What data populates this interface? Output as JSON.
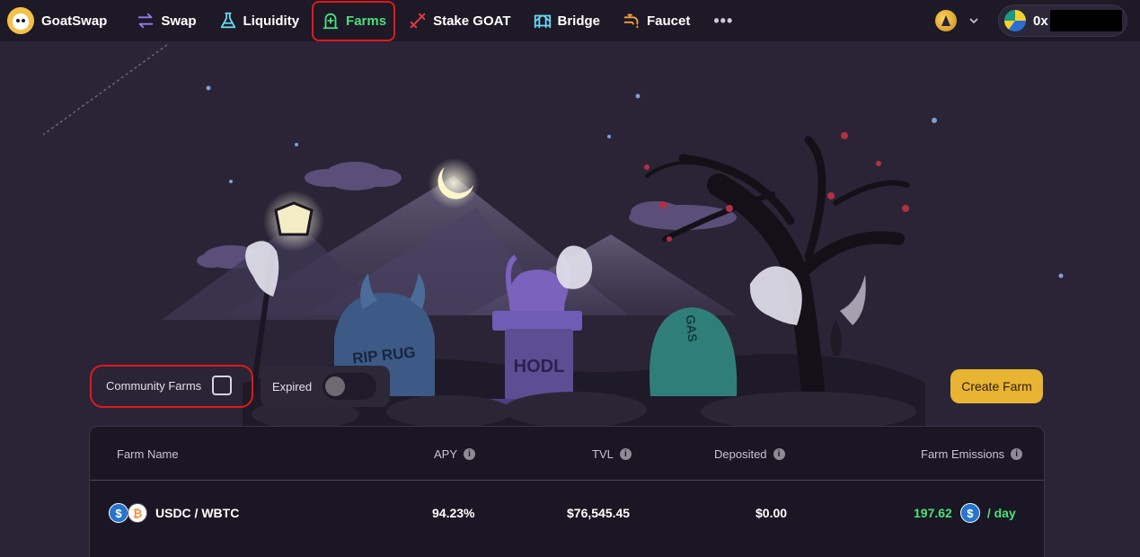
{
  "brand": {
    "name": "GoatSwap"
  },
  "nav": {
    "items": [
      {
        "label": "Swap",
        "icon": "swap-arrows-icon",
        "active": false
      },
      {
        "label": "Liquidity",
        "icon": "flask-icon",
        "active": false
      },
      {
        "label": "Farms",
        "icon": "tombstone-icon",
        "active": true
      },
      {
        "label": "Stake GOAT",
        "icon": "stake-icon",
        "active": false
      },
      {
        "label": "Bridge",
        "icon": "bridge-icon",
        "active": false
      },
      {
        "label": "Faucet",
        "icon": "faucet-icon",
        "active": false
      }
    ],
    "more_label": "•••"
  },
  "wallet": {
    "address_prefix": "0x"
  },
  "filters": {
    "community_label": "Community Farms",
    "community_checked": false,
    "expired_label": "Expired",
    "expired_on": false
  },
  "actions": {
    "create_farm": "Create Farm"
  },
  "table": {
    "headers": {
      "farm_name": "Farm Name",
      "apy": "APY",
      "tvl": "TVL",
      "deposited": "Deposited",
      "emissions": "Farm Emissions"
    },
    "rows": [
      {
        "pair": "USDC / WBTC",
        "apy": "94.23%",
        "tvl": "$76,545.45",
        "deposited": "$0.00",
        "emissions_value": "197.62",
        "emissions_unit": "/ day"
      }
    ]
  },
  "hero_text": {
    "tomb_left": "RIP RUG",
    "tomb_center": "HODL",
    "tomb_right": "GAS"
  },
  "colors": {
    "accent_green": "#4ce07a",
    "button_yellow": "#e8b431",
    "highlight_red": "#e01a1a",
    "background": "#2a2436"
  }
}
